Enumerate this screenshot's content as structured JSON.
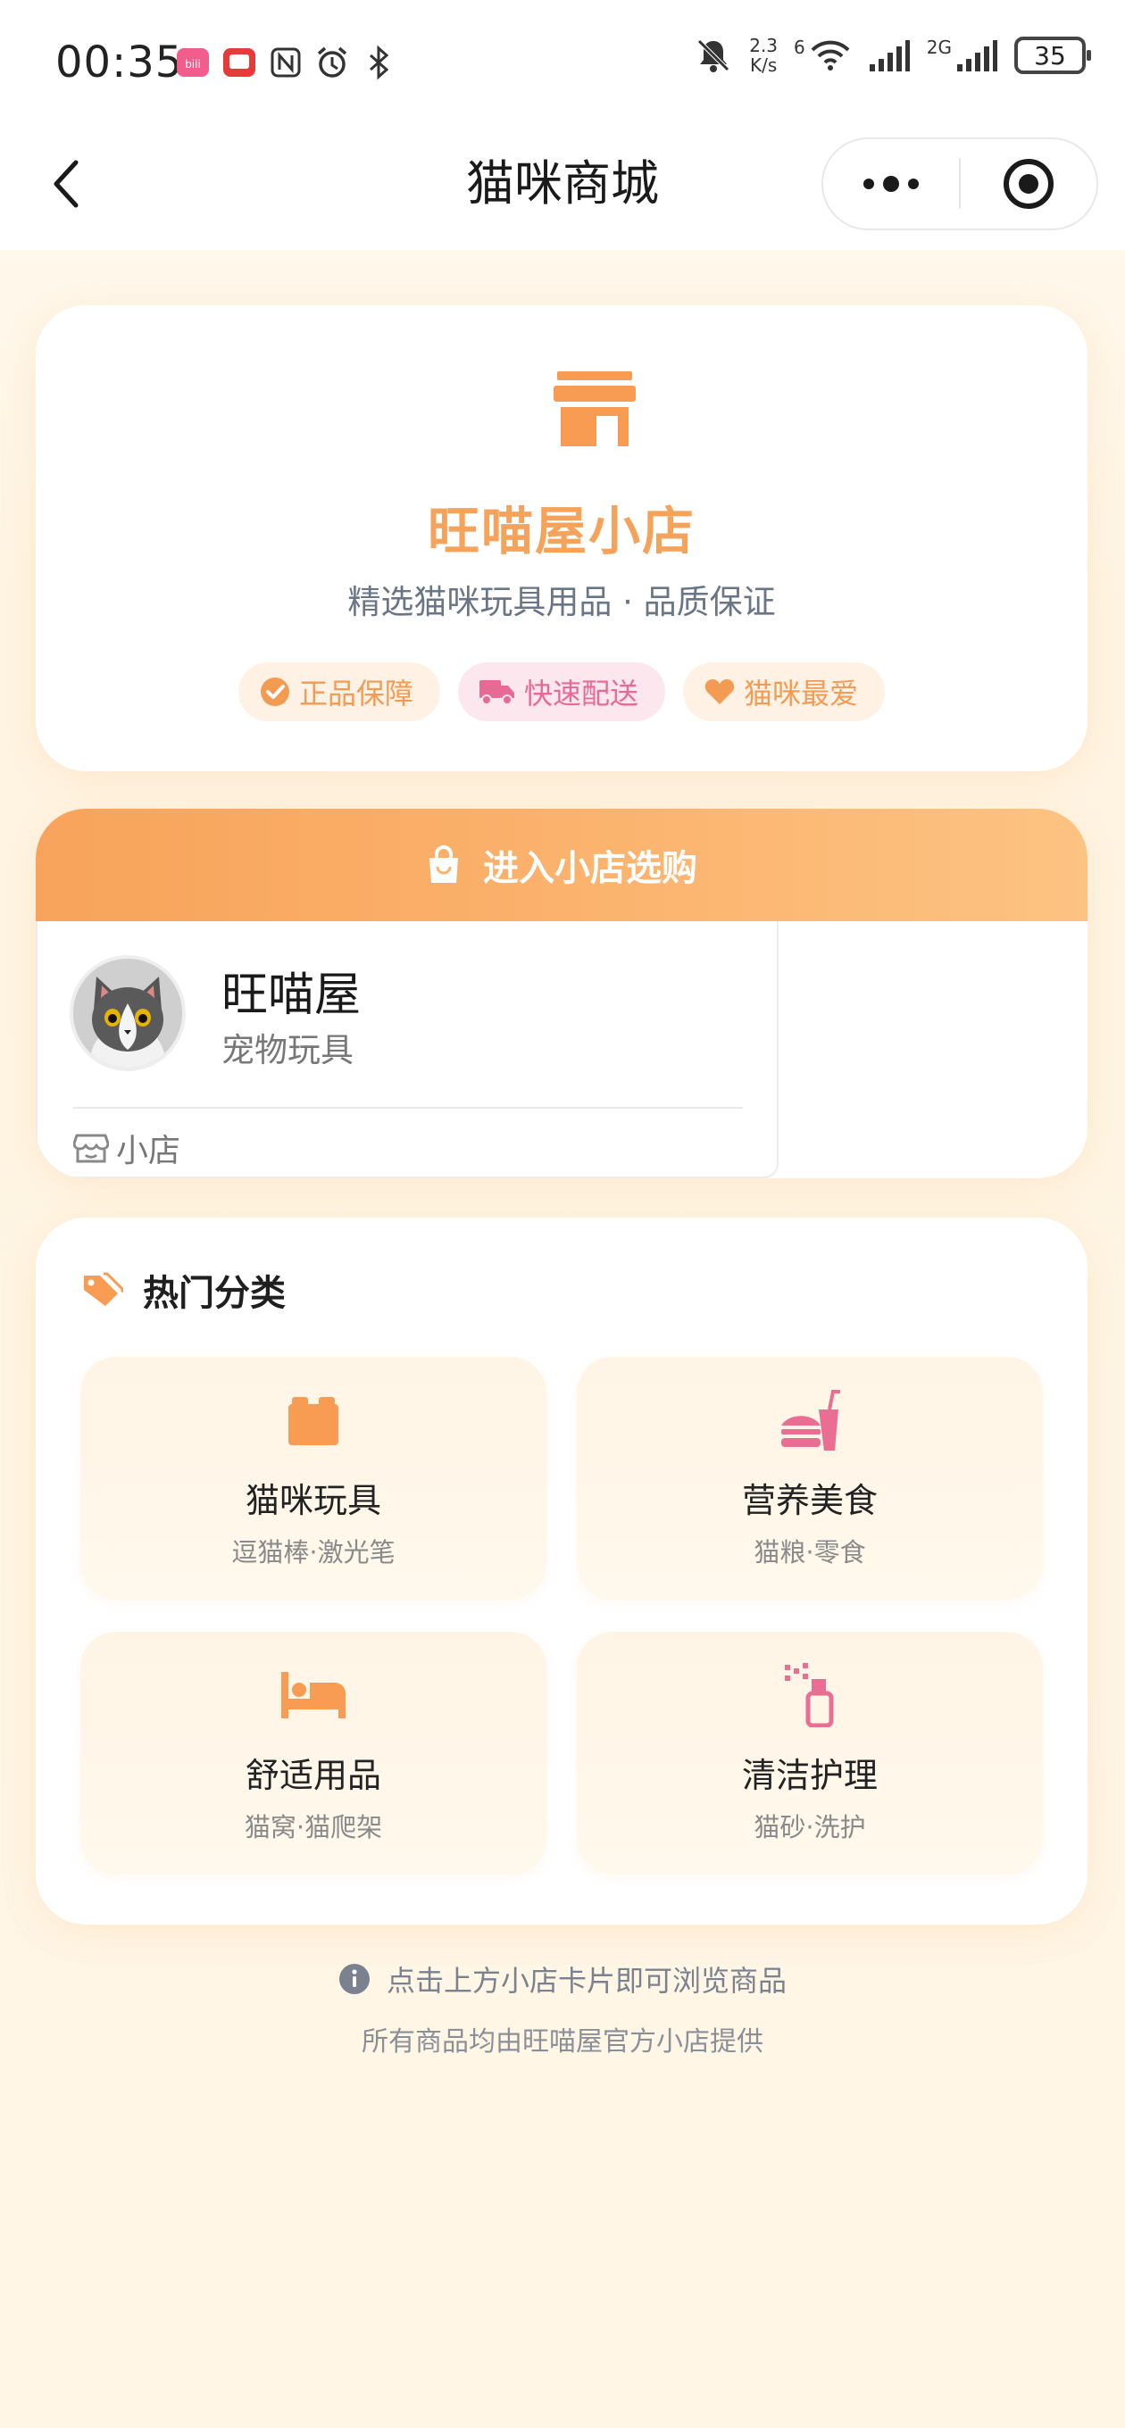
{
  "status_bar": {
    "time": "00:35",
    "net_speed_value": "2.3",
    "net_speed_unit": "K/s",
    "wifi_label": "6",
    "cell2_label": "2G",
    "battery": "35",
    "left_icons": [
      "bilibili-app-icon",
      "red-app-icon",
      "nfc-icon",
      "alarm-icon",
      "bluetooth-icon"
    ],
    "right_icons": [
      "mute-bell-icon",
      "wifi-icon",
      "signal-icon",
      "signal-2g-icon",
      "battery-icon"
    ]
  },
  "nav": {
    "title": "猫咪商城",
    "back_icon": "chevron-left-icon",
    "more_icon": "more-dots-icon",
    "close_icon": "target-close-icon"
  },
  "shop": {
    "icon": "storefront-icon",
    "name": "旺喵屋小店",
    "tagline": "精选猫咪玩具用品 · 品质保证",
    "badges": [
      {
        "icon": "check-circle-icon",
        "label": "正品保障",
        "color": "#f39b52"
      },
      {
        "icon": "truck-icon",
        "label": "快速配送",
        "color": "#e76a94"
      },
      {
        "icon": "heart-icon",
        "label": "猫咪最爱",
        "color": "#f39b52"
      }
    ]
  },
  "enter": {
    "icon": "shopping-bag-icon",
    "label": "进入小店选购",
    "store": {
      "name": "旺喵屋",
      "category": "宠物玩具",
      "footer_icon": "shop-outline-icon",
      "footer_label": "小店",
      "avatar": "cat-avatar"
    }
  },
  "categories": {
    "icon": "tags-icon",
    "title": "热门分类",
    "items": [
      {
        "icon": "toy-blocks-icon",
        "name": "猫咪玩具",
        "sub": "逗猫棒·激光笔",
        "color": "#f79c52"
      },
      {
        "icon": "burger-drink-icon",
        "name": "营养美食",
        "sub": "猫粮·零食",
        "color": "#ea6d94"
      },
      {
        "icon": "bed-icon",
        "name": "舒适用品",
        "sub": "猫窝·猫爬架",
        "color": "#f79c52"
      },
      {
        "icon": "spray-bottle-icon",
        "name": "清洁护理",
        "sub": "猫砂·洗护",
        "color": "#ea6d94"
      }
    ]
  },
  "footer": {
    "icon": "info-circle-icon",
    "tip": "点击上方小店卡片即可浏览商品",
    "note": "所有商品均由旺喵屋官方小店提供"
  },
  "colors": {
    "accent_orange": "#f5a35a",
    "accent_pink": "#e76a94",
    "background": "#fff6e6"
  }
}
